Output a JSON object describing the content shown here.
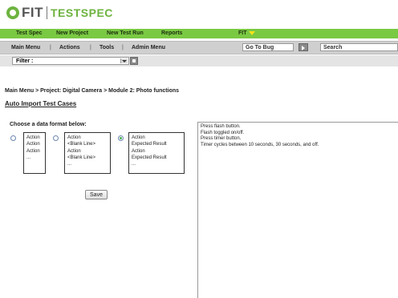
{
  "logo": {
    "part1": "FIT",
    "part2": "TESTSPEC"
  },
  "navbar": {
    "items": [
      "Test Spec",
      "New Project",
      "New Test Run",
      "Reports"
    ],
    "user": "FIT"
  },
  "toolbar": {
    "items": [
      "Main Menu",
      "Actions",
      "Tools",
      "Admin Menu"
    ],
    "separator": "|",
    "goto_bug": "Go To Bug",
    "search": "Search"
  },
  "filter": {
    "value": "Filter :"
  },
  "breadcrumb": "Main Menu > Project: Digital Camera > Module 2: Photo functions",
  "page_title": "Auto Import Test Cases",
  "choose_label": "Choose a data format below:",
  "formats": [
    {
      "lines": [
        "Action",
        "Action",
        "Action",
        "..."
      ],
      "selected": false
    },
    {
      "lines": [
        "Action",
        "<Blank Line>",
        "Action",
        "<Blank Line>",
        "..."
      ],
      "selected": false
    },
    {
      "lines": [
        "Action",
        "Expected Result",
        "Action",
        "Expected Result",
        "..."
      ],
      "selected": true
    }
  ],
  "save_label": "Save",
  "text_content": [
    "Press flash button.",
    "Flash toggled on/off.",
    "Press timer button.",
    "Timer cycles between 10 seconds, 30 seconds, and off."
  ],
  "colors": {
    "nav_green": "#7ac943",
    "logo_green": "#6db33f"
  }
}
